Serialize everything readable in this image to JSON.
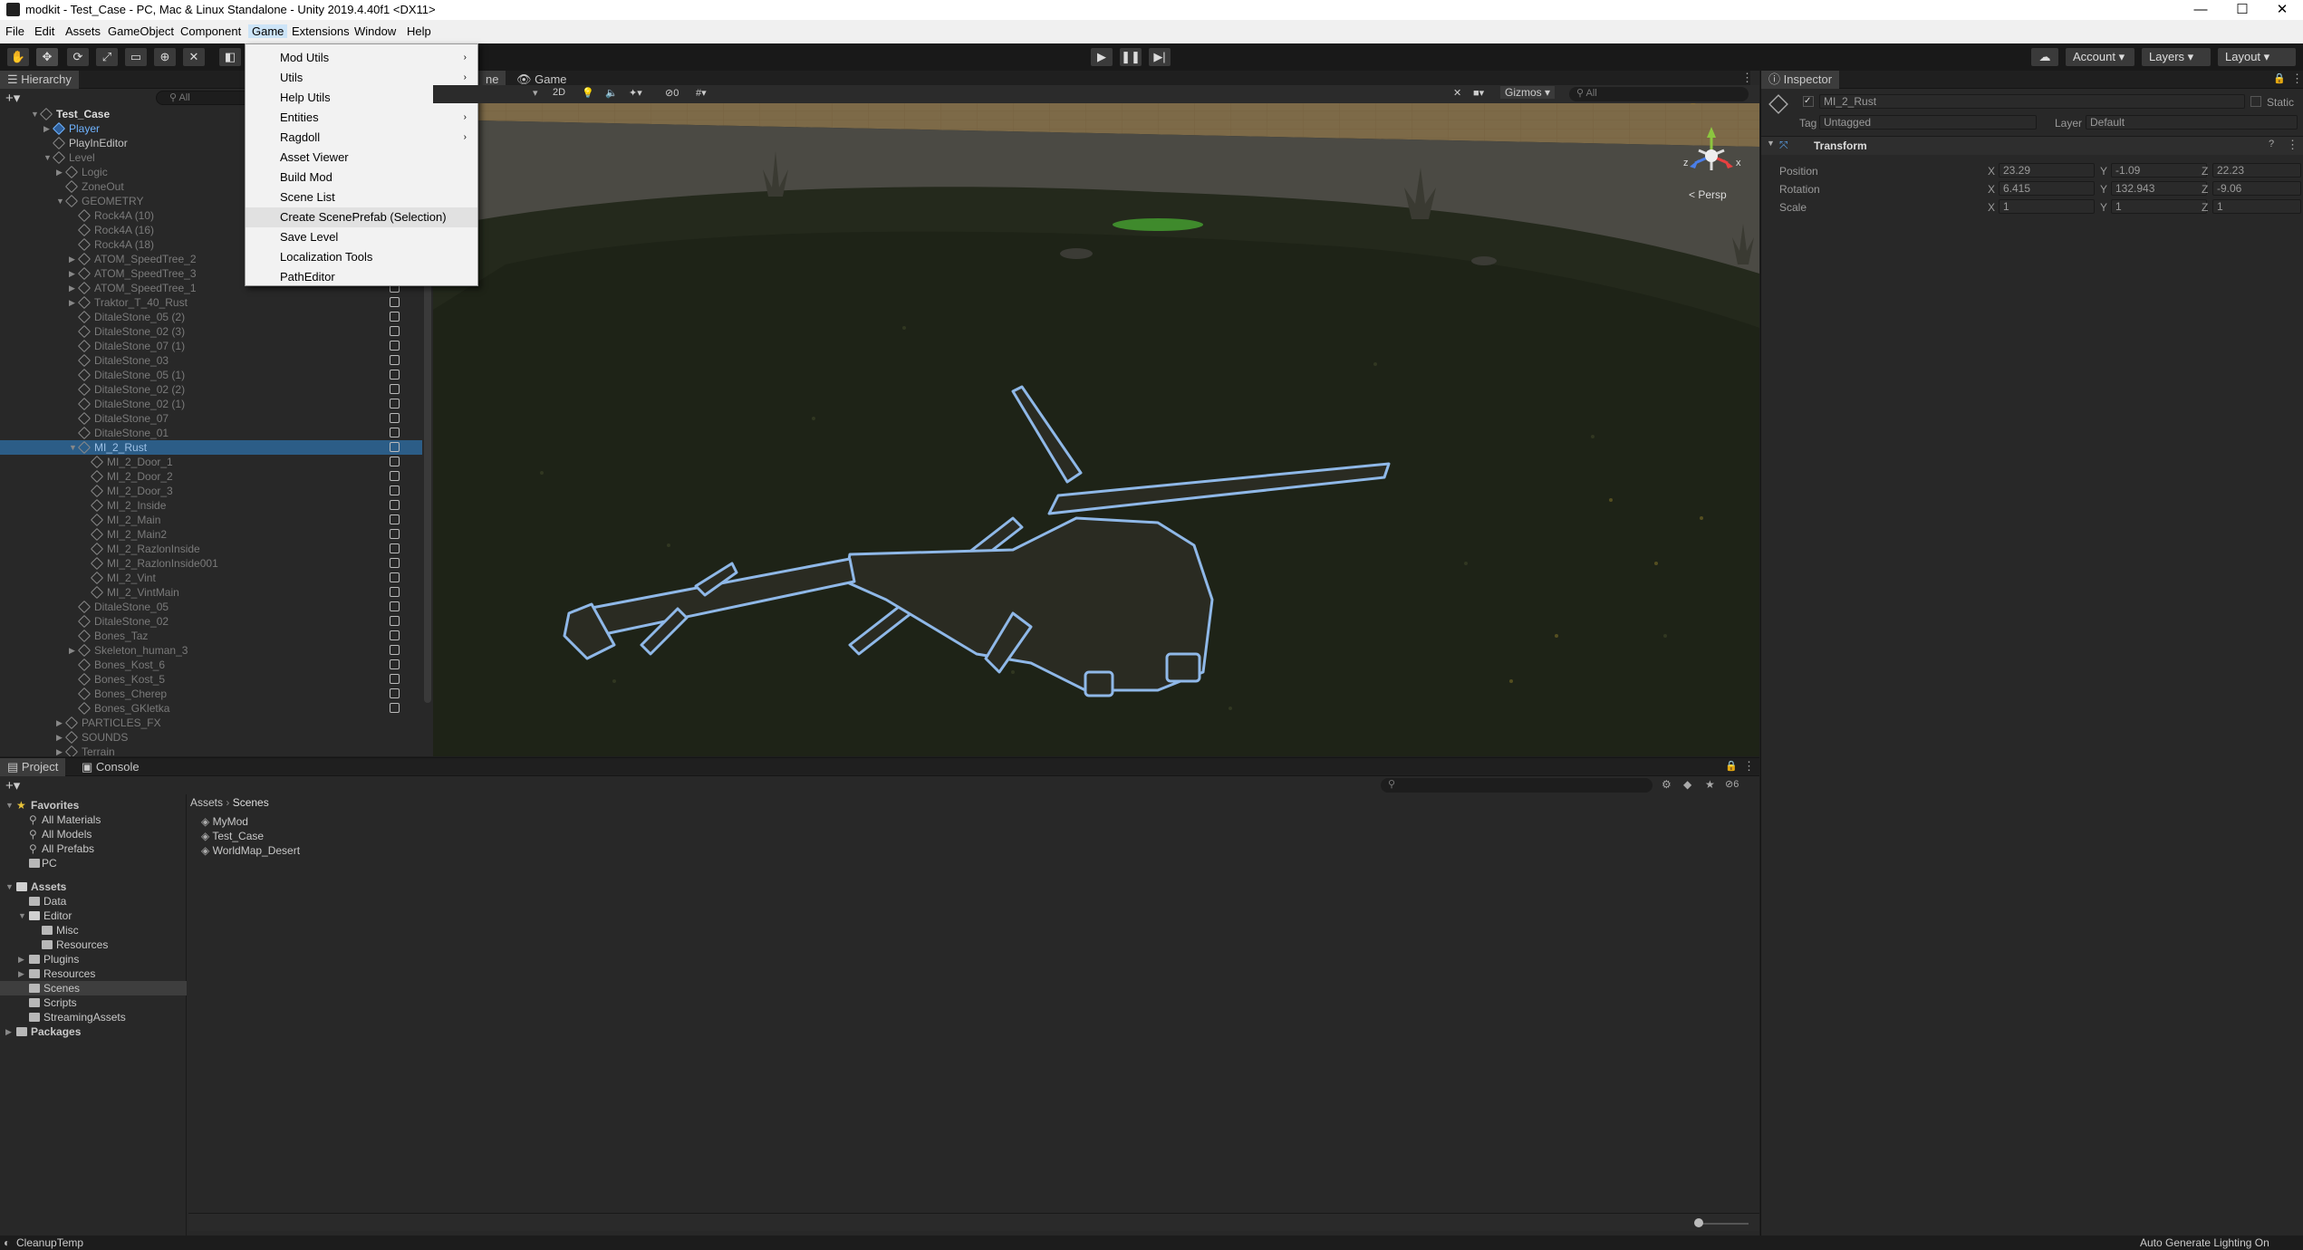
{
  "window": {
    "title": "modkit - Test_Case - PC, Mac & Linux Standalone - Unity 2019.4.40f1 <DX11>",
    "controls": [
      "—",
      "☐",
      "✕"
    ]
  },
  "menubar": [
    "File",
    "Edit",
    "Assets",
    "GameObject",
    "Component",
    "Game",
    "Extensions",
    "Window",
    "Help"
  ],
  "game_menu": {
    "items": [
      {
        "label": "Mod Utils",
        "submenu": "›"
      },
      {
        "label": "Utils",
        "submenu": "›"
      },
      {
        "label": "Help Utils",
        "submenu": "›"
      },
      {
        "label": "Entities",
        "submenu": "›"
      },
      {
        "label": "Ragdoll",
        "submenu": "›"
      },
      {
        "label": "Asset Viewer"
      },
      {
        "label": "Build Mod"
      },
      {
        "label": "Scene List"
      },
      {
        "label": "Create ScenePrefab (Selection)"
      },
      {
        "label": "Save Level"
      },
      {
        "label": "Localization Tools"
      },
      {
        "label": "PathEditor"
      }
    ],
    "highlighted": "Create ScenePrefab (Selection)"
  },
  "toolbar": {
    "account": "Account",
    "layers": "Layers",
    "layout": "Layout"
  },
  "hierarchy": {
    "tab": "Hierarchy",
    "search_placeholder": "All",
    "rows": [
      {
        "label": "Test_Case",
        "depth": 0,
        "arrow": "▼",
        "style": "bold"
      },
      {
        "label": "Player",
        "depth": 1,
        "arrow": "▶",
        "style": "blue"
      },
      {
        "label": "PlayInEditor",
        "depth": 1,
        "arrow": "",
        "style": "normal"
      },
      {
        "label": "Level",
        "depth": 1,
        "arrow": "▼",
        "style": "dim"
      },
      {
        "label": "Logic",
        "depth": 2,
        "arrow": "▶",
        "style": "dim"
      },
      {
        "label": "ZoneOut",
        "depth": 2,
        "arrow": "",
        "style": "dim"
      },
      {
        "label": "GEOMETRY",
        "depth": 2,
        "arrow": "▼",
        "style": "dim"
      },
      {
        "label": "Rock4A (10)",
        "depth": 3,
        "arrow": "",
        "style": "dim"
      },
      {
        "label": "Rock4A (16)",
        "depth": 3,
        "arrow": "",
        "style": "dim"
      },
      {
        "label": "Rock4A (18)",
        "depth": 3,
        "arrow": "",
        "style": "dim"
      },
      {
        "label": "ATOM_SpeedTree_2",
        "depth": 3,
        "arrow": "▶",
        "style": "dim"
      },
      {
        "label": "ATOM_SpeedTree_3",
        "depth": 3,
        "arrow": "▶",
        "style": "dim"
      },
      {
        "label": "ATOM_SpeedTree_1",
        "depth": 3,
        "arrow": "▶",
        "style": "dim"
      },
      {
        "label": "Traktor_T_40_Rust",
        "depth": 3,
        "arrow": "▶",
        "style": "dim"
      },
      {
        "label": "DitaleStone_05 (2)",
        "depth": 3,
        "arrow": "",
        "style": "dim"
      },
      {
        "label": "DitaleStone_02 (3)",
        "depth": 3,
        "arrow": "",
        "style": "dim"
      },
      {
        "label": "DitaleStone_07 (1)",
        "depth": 3,
        "arrow": "",
        "style": "dim"
      },
      {
        "label": "DitaleStone_03",
        "depth": 3,
        "arrow": "",
        "style": "dim"
      },
      {
        "label": "DitaleStone_05 (1)",
        "depth": 3,
        "arrow": "",
        "style": "dim"
      },
      {
        "label": "DitaleStone_02 (2)",
        "depth": 3,
        "arrow": "",
        "style": "dim"
      },
      {
        "label": "DitaleStone_02 (1)",
        "depth": 3,
        "arrow": "",
        "style": "dim"
      },
      {
        "label": "DitaleStone_07",
        "depth": 3,
        "arrow": "",
        "style": "dim"
      },
      {
        "label": "DitaleStone_01",
        "depth": 3,
        "arrow": "",
        "style": "dim"
      },
      {
        "label": "MI_2_Rust",
        "depth": 3,
        "arrow": "▼",
        "style": "selected"
      },
      {
        "label": "MI_2_Door_1",
        "depth": 4,
        "arrow": "",
        "style": "dim"
      },
      {
        "label": "MI_2_Door_2",
        "depth": 4,
        "arrow": "",
        "style": "dim"
      },
      {
        "label": "MI_2_Door_3",
        "depth": 4,
        "arrow": "",
        "style": "dim"
      },
      {
        "label": "MI_2_Inside",
        "depth": 4,
        "arrow": "",
        "style": "dim"
      },
      {
        "label": "MI_2_Main",
        "depth": 4,
        "arrow": "",
        "style": "dim"
      },
      {
        "label": "MI_2_Main2",
        "depth": 4,
        "arrow": "",
        "style": "dim"
      },
      {
        "label": "MI_2_RazlonInside",
        "depth": 4,
        "arrow": "",
        "style": "dim"
      },
      {
        "label": "MI_2_RazlonInside001",
        "depth": 4,
        "arrow": "",
        "style": "dim"
      },
      {
        "label": "MI_2_Vint",
        "depth": 4,
        "arrow": "",
        "style": "dim"
      },
      {
        "label": "MI_2_VintMain",
        "depth": 4,
        "arrow": "",
        "style": "dim"
      },
      {
        "label": "DitaleStone_05",
        "depth": 3,
        "arrow": "",
        "style": "dim"
      },
      {
        "label": "DitaleStone_02",
        "depth": 3,
        "arrow": "",
        "style": "dim"
      },
      {
        "label": "Bones_Taz",
        "depth": 3,
        "arrow": "",
        "style": "dim"
      },
      {
        "label": "Skeleton_human_3",
        "depth": 3,
        "arrow": "▶",
        "style": "dim"
      },
      {
        "label": "Bones_Kost_6",
        "depth": 3,
        "arrow": "",
        "style": "dim"
      },
      {
        "label": "Bones_Kost_5",
        "depth": 3,
        "arrow": "",
        "style": "dim"
      },
      {
        "label": "Bones_Cherep",
        "depth": 3,
        "arrow": "",
        "style": "dim"
      },
      {
        "label": "Bones_GKletka",
        "depth": 3,
        "arrow": "",
        "style": "dim"
      },
      {
        "label": "PARTICLES_FX",
        "depth": 2,
        "arrow": "▶",
        "style": "dim"
      },
      {
        "label": "SOUNDS",
        "depth": 2,
        "arrow": "▶",
        "style": "dim"
      },
      {
        "label": "Terrain",
        "depth": 2,
        "arrow": "▶",
        "style": "dim"
      }
    ]
  },
  "scene": {
    "tab_partial": "ne",
    "game_tab": "Game",
    "mode_2d": "2D",
    "hidden_count": "0",
    "gizmos": "Gizmos",
    "search_placeholder": "All",
    "persp": "< Persp",
    "axis_y": "y",
    "axis_x": "x",
    "axis_z": "z"
  },
  "inspector": {
    "tab": "Inspector",
    "object_name": "MI_2_Rust",
    "static_label": "Static",
    "tag_label": "Tag",
    "tag_value": "Untagged",
    "layer_label": "Layer",
    "layer_value": "Default",
    "component": "Transform",
    "position": {
      "label": "Position",
      "x": "23.29",
      "y": "-1.09",
      "z": "22.23"
    },
    "rotation": {
      "label": "Rotation",
      "x": "6.415",
      "y": "132.943",
      "z": "-9.06"
    },
    "scale": {
      "label": "Scale",
      "x": "1",
      "y": "1",
      "z": "1"
    }
  },
  "project": {
    "tabs": [
      "Project",
      "Console"
    ],
    "breadcrumb": [
      "Assets",
      "Scenes"
    ],
    "hidden_count": "6",
    "favorites": {
      "label": "Favorites",
      "items": [
        "All Materials",
        "All Models",
        "All Prefabs",
        "PC"
      ]
    },
    "tree": [
      {
        "label": "Assets",
        "depth": 0,
        "arrow": "▼",
        "bold": true
      },
      {
        "label": "Data",
        "depth": 1,
        "arrow": ""
      },
      {
        "label": "Editor",
        "depth": 1,
        "arrow": "▼"
      },
      {
        "label": "Misc",
        "depth": 2,
        "arrow": ""
      },
      {
        "label": "Resources",
        "depth": 2,
        "arrow": ""
      },
      {
        "label": "Plugins",
        "depth": 1,
        "arrow": "▶"
      },
      {
        "label": "Resources",
        "depth": 1,
        "arrow": "▶"
      },
      {
        "label": "Scenes",
        "depth": 1,
        "arrow": "",
        "selected": true
      },
      {
        "label": "Scripts",
        "depth": 1,
        "arrow": ""
      },
      {
        "label": "StreamingAssets",
        "depth": 1,
        "arrow": ""
      },
      {
        "label": "Packages",
        "depth": 0,
        "arrow": "▶",
        "bold": true
      }
    ],
    "files": [
      "MyMod",
      "Test_Case",
      "WorldMap_Desert"
    ]
  },
  "statusbar": {
    "left": "CleanupTemp",
    "right": "Auto Generate Lighting On"
  },
  "colors": {
    "selection": "#2c5d87",
    "outline": "#8fb8e8",
    "accent_blue": "#6fb3ff"
  }
}
